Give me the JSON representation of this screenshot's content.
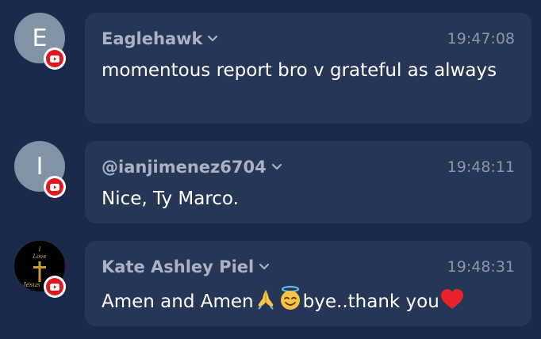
{
  "messages": [
    {
      "avatar_letter": "E",
      "author": "Eaglehawk",
      "time": "19:47:08",
      "text": "momentous report bro v grateful as always",
      "badge_icon": "youtube-icon"
    },
    {
      "avatar_letter": "I",
      "author": "@ianjimenez6704",
      "time": "19:48:11",
      "text": "Nice, Ty Marco.",
      "badge_icon": "youtube-icon"
    },
    {
      "avatar_text_top": "I",
      "avatar_text_mid": "Love",
      "avatar_text_bottom": "Jesus",
      "author": "Kate Ashley Piel",
      "time": "19:48:31",
      "text_part1": "Amen and Amen",
      "text_part2": "bye..thank you",
      "emojis": [
        "folded-hands-emoji",
        "smiling-face-with-halo-emoji",
        "red-heart-emoji"
      ],
      "badge_icon": "youtube-icon"
    }
  ],
  "colors": {
    "background": "#1b2a4a",
    "bubble": "#253656",
    "author": "#a9b3c1",
    "timestamp": "#8d96a5",
    "youtube_red": "#e0181e"
  }
}
